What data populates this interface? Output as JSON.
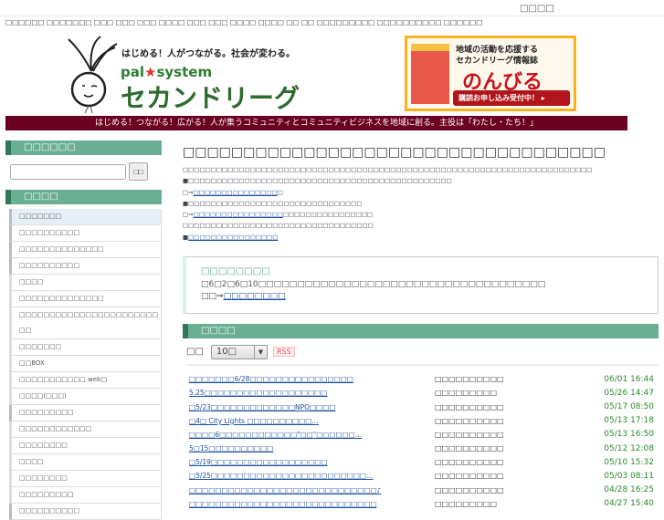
{
  "topbar": {
    "link": "□□□□"
  },
  "crumbs": "□□□□□□ □□□□□□□ □□□ □□□ □□□ □□□□ □□□ □□□ □□□□ □□□□ □□ □□ □□□□□□□□□ □□□□□□□□□□ □□□□□□",
  "logo": {
    "tagline": "はじめる！人がつながる。社会が変わる。",
    "brand": "pal",
    "brand2": "system",
    "name": "セカンドリーグ"
  },
  "ad": {
    "line1": "地域の活動を応援する",
    "line2": "セカンドリーグ情報誌",
    "title": "のんびる",
    "button": "購読お申し込み受付中！ ▸"
  },
  "banner": "はじめる！つながる！広がる！人が集うコミュニティとコミュニティビジネスを地域に創る。主役は「わたし・たち！」",
  "sidebar": {
    "search_title": "□□□□□□",
    "search_button": "□□",
    "menu_title": "□□□□",
    "items": [
      "□□□□□□□",
      "□□□□□□□□□□",
      "□□□□□□□□□□□□□□",
      "□□□□□□□□□□",
      "□□□□",
      "□□□□□□□□□□□□□□",
      "□□□□□□□□□□□□□□□□□□□□□□□□□",
      "□□□□□□□",
      "□□BOX",
      "□□□□□□□□□□□.web□",
      "□□□□(□□□)",
      "□□□□□□□□□",
      "□□□□□□□□□□□□",
      "□□□□□□□□",
      "□□□□",
      "□□□□□□□□",
      "□□□□□□□□□",
      "□□□□□□□□□□"
    ]
  },
  "main": {
    "title": "□□□□□□□□□□□□□□□□□□□□□□□□□□□□□□□□□□□",
    "lines": [
      "□□□□□□□□□□□□□□□□□□□□□□□□□□□□□□□□□□□□□□□□□□□□□□□□□□□□□□□□□□□□□□□□□□□□□□□□□",
      "■□□□□□□□□□□□□□□□□□□□□□□□□□□□□□□□□□□□□□□□□□□□□□□□"
    ],
    "link1_pre": "□⇒",
    "link1": "□□□□□□□□□□□□□□□",
    "link1_post": "□",
    "line3": "■□□□□□□□□□□□□□□□□□□□□□□□□□□□□□□□",
    "link2_pre": "□⇒",
    "link2": "□□□□□□□□□□□□□□□□",
    "link2_post": "□□□□□□□□□□□□□□□□",
    "line5": "□□□□□□□□□□□□□□□□□□□□□□□□□□□□□□□□□□",
    "link3_pre": "■",
    "link3": "□□□□□□□□□□□□□□□□"
  },
  "notice": {
    "title": "□□□□□□□□",
    "message": "□6□2□6□10□□□□□□□□□□□□□□□□□□□□□□□□□□□□□□□□□□□□□",
    "more_pre": "□□⇒",
    "more": "□□□□□□□□"
  },
  "news": {
    "title": "□□□□",
    "show_label": "□□",
    "select": "10□",
    "rss": "RSS",
    "rows": [
      {
        "title": "□□□□□□□6/28□□□□□□□□□□□□□□□□",
        "author": "□□□□□□□□□□",
        "date": "06/01 16:44"
      },
      {
        "title": "5.25□□□□□□□□□□□□□□□□□□□",
        "author": "□□□□□□□□□",
        "date": "05/26 14:47"
      },
      {
        "title": "□5/23□□□□□□□□□□□□□NPO□□□□",
        "author": "□□□□□□□□□□",
        "date": "05/17 08:50"
      },
      {
        "title": "□4□ City Lights □□□□□□□□□□…",
        "author": "□□□□□□□□□□",
        "date": "05/13 17:18"
      },
      {
        "title": "□□□□6□□□□□□□□□□□□\"□□\"□□□□□□…",
        "author": "□□□□□□□□□□",
        "date": "05/13 16:50"
      },
      {
        "title": "5□15□□□□□□□□□□",
        "author": "□□□□□□□□□□",
        "date": "05/12 12:08"
      },
      {
        "title": "□5/19□□□□□□□□□□□□□□□□□□",
        "author": "□□□□□□□□□□",
        "date": "05/10 15:32"
      },
      {
        "title": "□5/25□□□□□□□□□□□□□□□□□□□□□□□□…",
        "author": "□□□□□□□□□□",
        "date": "05/03 08:11"
      },
      {
        "title": "□□□□□□□□□□□□□□□□□□□□□□□□□□□□□♪",
        "author": "□□□□□□□□□□",
        "date": "04/28 16:25"
      },
      {
        "title": "□□□□□□□□□□□□□□□□□□□□□□□□□□□□□",
        "author": "□□□□□□□□□",
        "date": "04/27 15:40"
      }
    ]
  }
}
